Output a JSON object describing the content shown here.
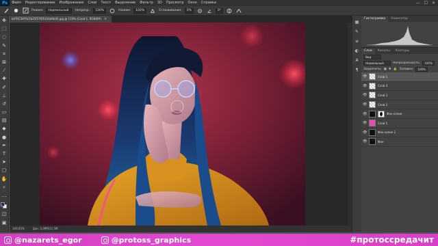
{
  "app": {
    "logo": "Ps"
  },
  "menu": [
    "Файл",
    "Редактирование",
    "Изображение",
    "Слои",
    "Текст",
    "Выделение",
    "Фильтр",
    "3D",
    "Просмотр",
    "Окно",
    "Справка"
  ],
  "window_controls": [
    "—",
    "☐",
    "✕"
  ],
  "options_bar": {
    "mode_label": "Режим:",
    "mode_value": "Нормальный",
    "opacity_label": "Непрозр.:",
    "opacity_value": "100%",
    "flow_label": "Нажим:",
    "flow_value": "100%",
    "smoothing_label": "Сглаживание:",
    "smoothing_value": "0%",
    "angle_value": "0°"
  },
  "document": {
    "tab_title": "bAT0C58Y0c5b25f57f05104b9bd5.jpg @ 110% (Слой 1, RGB/8#)",
    "status_zoom": "109,65%",
    "status_doc": "Док: 2,09M/11,5M"
  },
  "panels": {
    "top_tabs": [
      "Гистограмма",
      "Навигатор"
    ],
    "layer_tabs": [
      "Слои",
      "Каналы",
      "Контуры"
    ],
    "kind_label": "Вид",
    "blend_mode": "Нормальный",
    "opacity_label": "Непрозрачность:",
    "opacity_value": "100%",
    "lock_label": "Закрепить:",
    "fill_label": "Заливка:",
    "fill_value": "100%"
  },
  "layers": [
    {
      "name": "Слой 1",
      "thumb": "check",
      "selected": true
    },
    {
      "name": "Слой 4",
      "thumb": "check",
      "selected": false
    },
    {
      "name": "Слой 3",
      "thumb": "check",
      "selected": false
    },
    {
      "name": "Слой 2",
      "thumb": "check",
      "selected": false
    },
    {
      "name": "Фон копия",
      "thumb": "black",
      "selected": false
    },
    {
      "name": "Слой 5",
      "thumb": "pink",
      "selected": false
    },
    {
      "name": "Фон копия 2",
      "thumb": "black",
      "selected": false
    },
    {
      "name": "Фон",
      "thumb": "black",
      "selected": false
    }
  ],
  "watermark": {
    "left_handle": "@nazarets_egor",
    "right_handle": "@protoss_graphics",
    "hashtag": "#протоссредачит"
  },
  "colors": {
    "watermark_bg": "#df46cc",
    "fg_swatch": "#1a2c6e",
    "bg_swatch": "#ffffff"
  }
}
